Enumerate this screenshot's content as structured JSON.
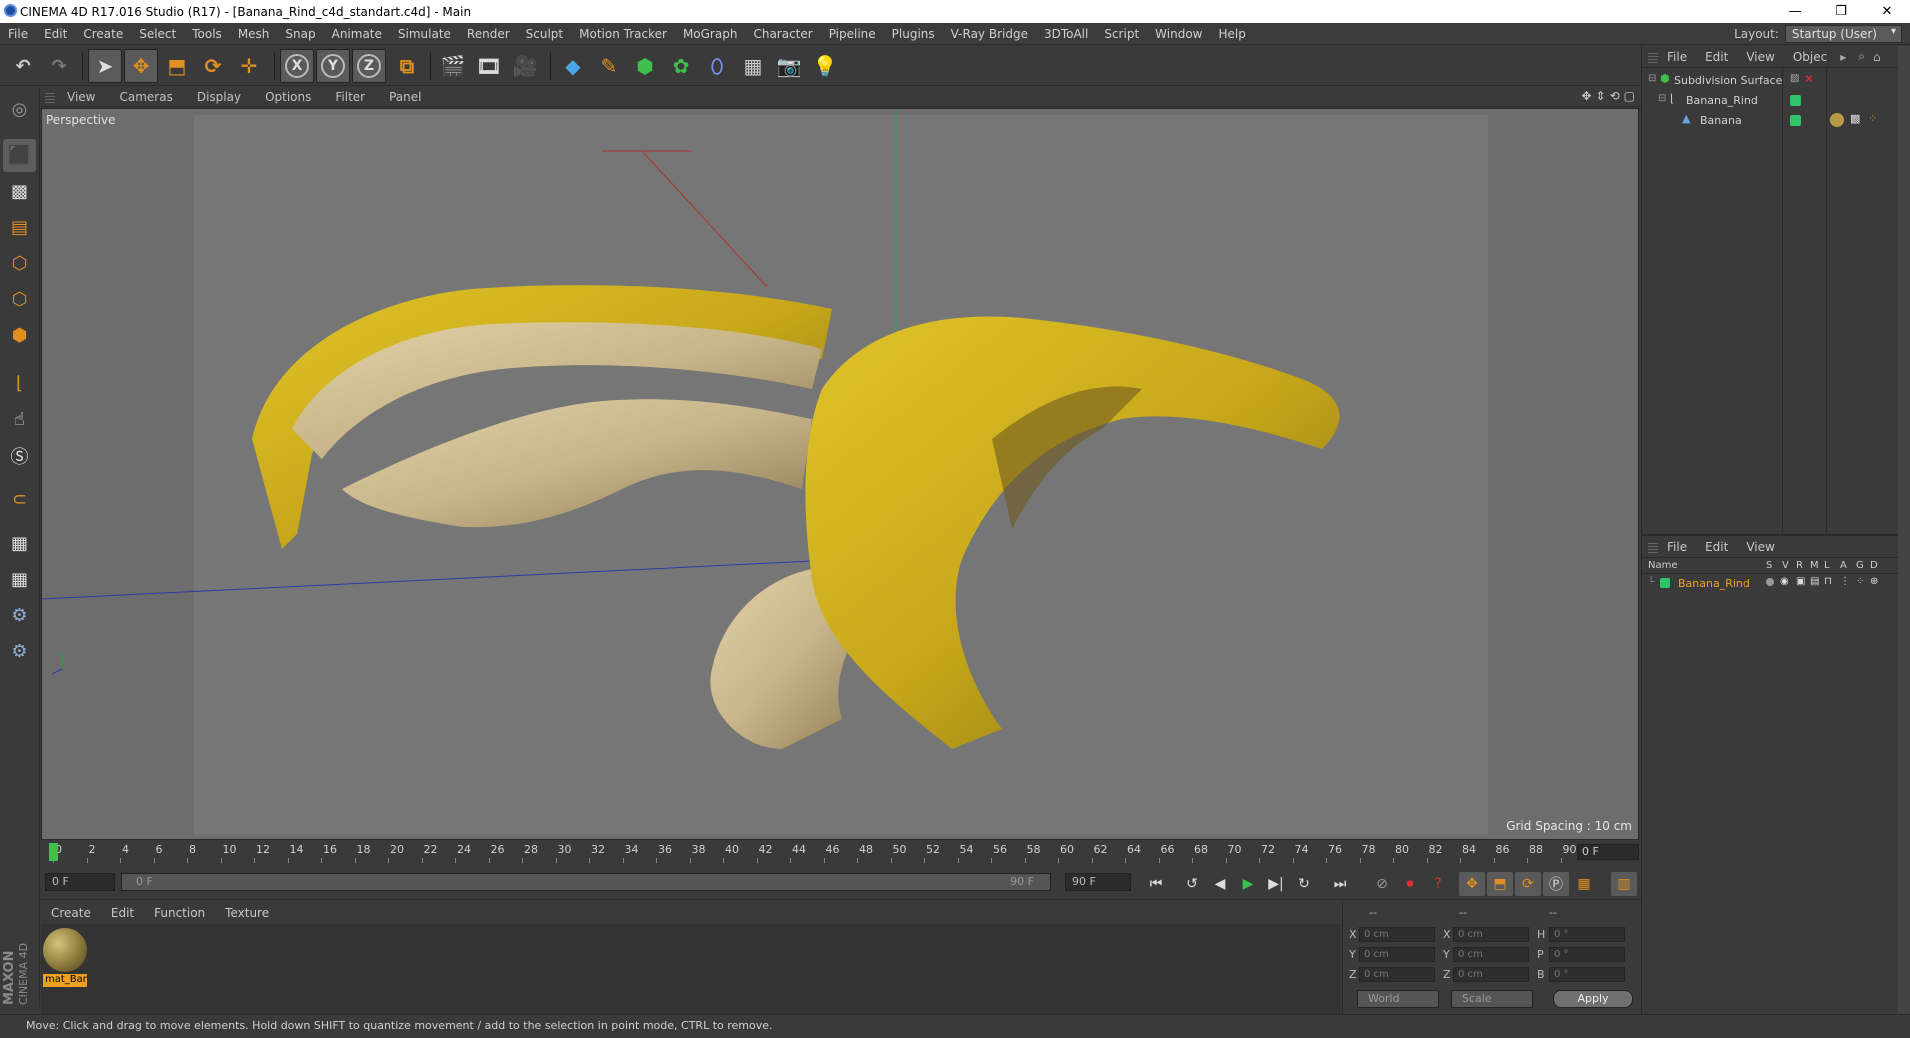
{
  "window": {
    "title": "CINEMA 4D R17.016 Studio (R17) - [Banana_Rind_c4d_standart.c4d] - Main",
    "minimize": "—",
    "restore": "❐",
    "close": "✕"
  },
  "menu": [
    "File",
    "Edit",
    "Create",
    "Select",
    "Tools",
    "Mesh",
    "Snap",
    "Animate",
    "Simulate",
    "Render",
    "Sculpt",
    "Motion Tracker",
    "MoGraph",
    "Character",
    "Pipeline",
    "Plugins",
    "V-Ray Bridge",
    "3DToAll",
    "Script",
    "Window",
    "Help"
  ],
  "layout": {
    "label": "Layout:",
    "value": "Startup (User)"
  },
  "viewport": {
    "menu": [
      "View",
      "Cameras",
      "Display",
      "Options",
      "Filter",
      "Panel"
    ],
    "label": "Perspective",
    "grid_spacing": "Grid Spacing : 10 cm"
  },
  "timeline": {
    "ticks": [
      "0",
      "2",
      "4",
      "6",
      "8",
      "10",
      "12",
      "14",
      "16",
      "18",
      "20",
      "22",
      "24",
      "26",
      "28",
      "30",
      "32",
      "34",
      "36",
      "38",
      "40",
      "42",
      "44",
      "46",
      "48",
      "50",
      "52",
      "54",
      "56",
      "58",
      "60",
      "62",
      "64",
      "66",
      "68",
      "70",
      "72",
      "74",
      "76",
      "78",
      "80",
      "82",
      "84",
      "86",
      "88",
      "90"
    ],
    "current_frame": "0 F",
    "start_field": "0 F",
    "range_start": "0 F",
    "range_end": "90 F",
    "end_field": "90 F"
  },
  "material": {
    "menu": [
      "Create",
      "Edit",
      "Function",
      "Texture"
    ],
    "items": [
      {
        "name": "mat_Bar"
      }
    ]
  },
  "coordinates": {
    "headers": [
      "--",
      "--",
      "--"
    ],
    "rows": [
      {
        "a": "X",
        "av": "0 cm",
        "b": "X",
        "bv": "0 cm",
        "c": "H",
        "cv": "0 °"
      },
      {
        "a": "Y",
        "av": "0 cm",
        "b": "Y",
        "bv": "0 cm",
        "c": "P",
        "cv": "0 °"
      },
      {
        "a": "Z",
        "av": "0 cm",
        "b": "Z",
        "bv": "0 cm",
        "c": "B",
        "cv": "0 °"
      }
    ],
    "space": "World",
    "mode": "Scale",
    "apply": "Apply"
  },
  "object_manager": {
    "menu": [
      "File",
      "Edit",
      "View",
      "Objec"
    ],
    "objects": [
      {
        "name": "Subdivision Surface",
        "level": 0
      },
      {
        "name": "Banana_Rind",
        "level": 1
      },
      {
        "name": "Banana",
        "level": 2
      }
    ]
  },
  "attribute_manager": {
    "menu": [
      "File",
      "Edit",
      "View"
    ],
    "columns": [
      "Name",
      "S",
      "V",
      "R",
      "M",
      "L",
      "A",
      "G",
      "D"
    ],
    "rows": [
      {
        "name": "Banana_Rind"
      }
    ]
  },
  "status": "Move: Click and drag to move elements. Hold down SHIFT to quantize movement / add to the selection in point mode, CTRL to remove.",
  "branding": {
    "maxon": "MAXON",
    "cinema": "CINEMA 4D"
  },
  "colors": {
    "accent": "#f0a020",
    "play": "#3fc04c",
    "obj_dot": "#2fc46a"
  }
}
